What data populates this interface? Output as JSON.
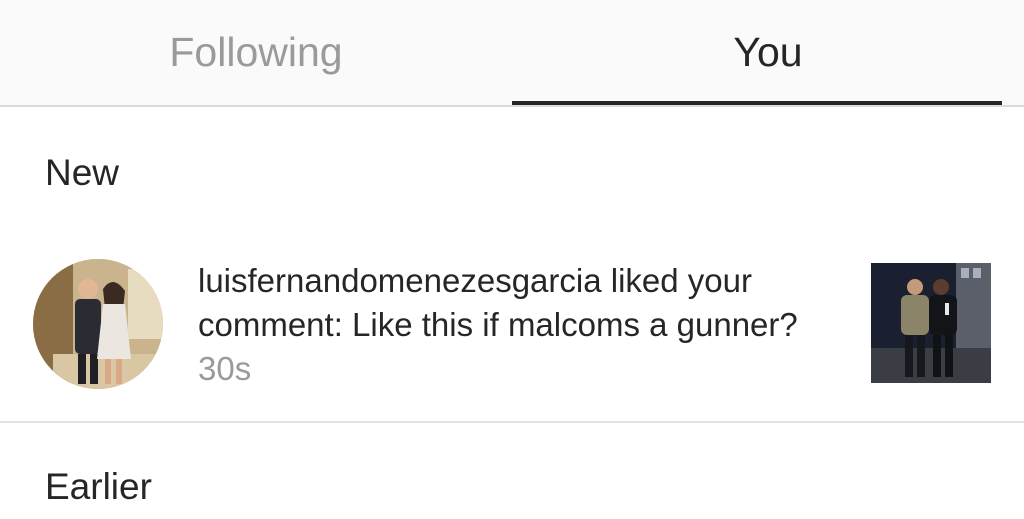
{
  "tabs": {
    "following_label": "Following",
    "you_label": "You"
  },
  "sections": {
    "new_label": "New",
    "earlier_label": "Earlier"
  },
  "notification": {
    "username": "luisfernandomenezesgarcia",
    "action_text": " liked your comment: Like this if malcoms a gunner? ",
    "time": "30s"
  },
  "colors": {
    "active_tab_text": "#262626",
    "inactive_tab_text": "#9a9a9a",
    "timestamp": "#9a9a9a",
    "underline": "#262626"
  }
}
